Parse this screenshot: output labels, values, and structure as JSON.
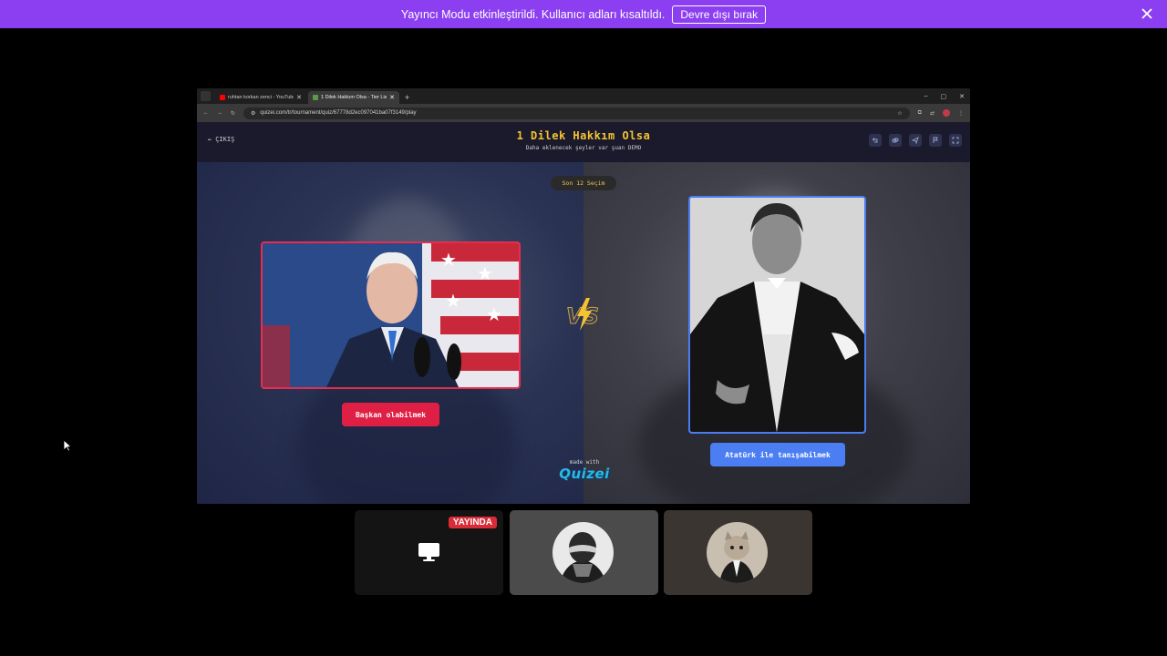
{
  "banner": {
    "message": "Yayıncı Modu etkinleştirildi. Kullanıcı adları kısaltıldı.",
    "disable_label": "Devre dışı bırak"
  },
  "browser": {
    "tabs": [
      {
        "title": "ruhtan korkan zenci - YouTube",
        "favicon_color": "#ff0000"
      },
      {
        "title": "1 Dilek Hakkım Olsa - Tier List",
        "favicon_color": "#5a9a4a"
      }
    ],
    "url": "quizei.com/tr/tournament/quiz/67778d2ec097041ba07f3149/play"
  },
  "quiz": {
    "exit_label": "ÇIKIŞ",
    "title": "1 Dilek Hakkım Olsa",
    "subtitle": "Daha eklenecek şeyler var şuan DEMO",
    "counter": "Son 12 Seçim",
    "left_choice": "Başkan olabilmek",
    "right_choice": "Atatürk ile tanışabilmek",
    "made_with": "made with",
    "brand": "Quizei"
  },
  "stream": {
    "live_badge": "YAYINDA"
  },
  "colors": {
    "banner": "#8b3ff0",
    "title_gold": "#f4c331",
    "left_accent": "#e01f44",
    "right_accent": "#4a7ef2",
    "live_red": "#d92b38"
  }
}
